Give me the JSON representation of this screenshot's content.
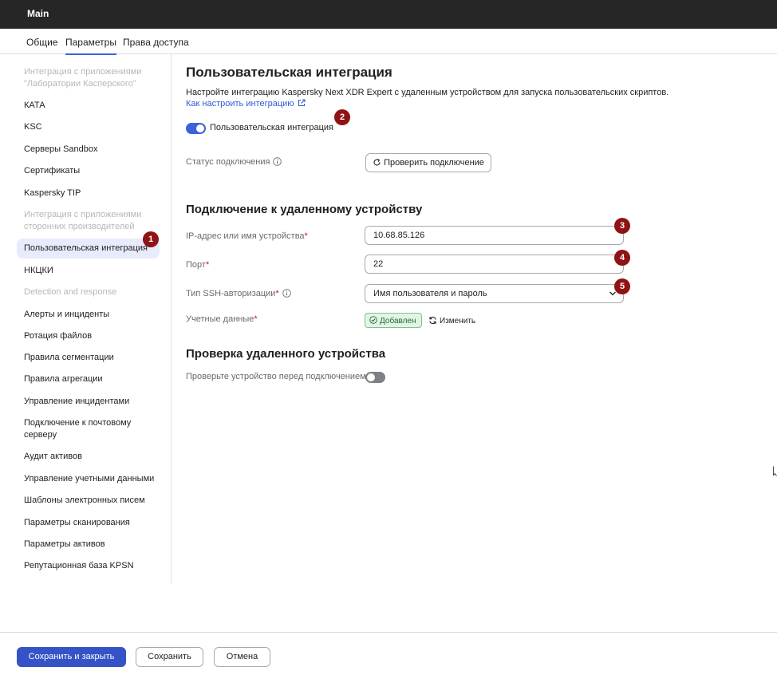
{
  "window": {
    "title": "Main"
  },
  "tabs": [
    {
      "label": "Общие"
    },
    {
      "label": "Параметры"
    },
    {
      "label": "Права доступа"
    }
  ],
  "sidebar": {
    "items": [
      {
        "label": "Интеграция с приложениями \"Лаборатории Касперского\"",
        "type": "group"
      },
      {
        "label": "КАТА",
        "type": "item"
      },
      {
        "label": "KSC",
        "type": "item"
      },
      {
        "label": "Серверы Sandbox",
        "type": "item"
      },
      {
        "label": "Сертификаты",
        "type": "item"
      },
      {
        "label": "Kaspersky TIP",
        "type": "item"
      },
      {
        "label": "Интеграция с приложениями сторонних производителей",
        "type": "group"
      },
      {
        "label": "Пользовательская интеграция",
        "type": "item",
        "selected": true
      },
      {
        "label": "НКЦКИ",
        "type": "item"
      },
      {
        "label": "Detection and response",
        "type": "group"
      },
      {
        "label": "Алерты и инциденты",
        "type": "item"
      },
      {
        "label": "Ротация файлов",
        "type": "item"
      },
      {
        "label": "Правила сегментации",
        "type": "item"
      },
      {
        "label": "Правила агрегации",
        "type": "item"
      },
      {
        "label": "Управление инцидентами",
        "type": "item"
      },
      {
        "label": "Подключение к почтовому серверу",
        "type": "item"
      },
      {
        "label": "Аудит активов",
        "type": "item"
      },
      {
        "label": "Управление учетными данными",
        "type": "item"
      },
      {
        "label": "Шаблоны электронных писем",
        "type": "item"
      },
      {
        "label": "Параметры сканирования",
        "type": "item"
      },
      {
        "label": "Параметры активов",
        "type": "item"
      },
      {
        "label": "Репутационная база KPSN",
        "type": "item"
      }
    ]
  },
  "main": {
    "title": "Пользовательская интеграция",
    "description": "Настройте интеграцию Kaspersky Next XDR Expert с удаленным устройством для запуска пользовательских скриптов.",
    "help_link": "Как настроить интеграцию",
    "integration_toggle": {
      "label": "Пользовательская интеграция",
      "on": true
    },
    "connection_status": {
      "label": "Статус подключения",
      "check_button": "Проверить подключение"
    },
    "remote_section": {
      "title": "Подключение к удаленному устройству",
      "ip": {
        "label": "IP-адрес или имя устройства",
        "required_mark": "*",
        "value": "10.68.85.126"
      },
      "port": {
        "label": "Порт",
        "required_mark": "*",
        "value": "22"
      },
      "ssh_auth": {
        "label": "Тип SSH-авторизации",
        "required_mark": "*",
        "value": "Имя пользователя и пароль"
      },
      "credentials": {
        "label": "Учетные данные",
        "required_mark": "*",
        "status": "Добавлен",
        "change_label": "Изменить"
      }
    },
    "verify_section": {
      "title": "Проверка удаленного устройства",
      "toggle_label": "Проверьте устройство перед подключением",
      "toggle_on": false
    }
  },
  "callouts": [
    "1",
    "2",
    "3",
    "4",
    "5"
  ],
  "footer": {
    "save_close": "Сохранить и закрыть",
    "save": "Сохранить",
    "cancel": "Отмена"
  },
  "colors": {
    "accent": "#3a64d8",
    "primary_button": "#3553c7",
    "callout": "#8f1214",
    "titlebar": "#262626",
    "success": "#1f6b33"
  }
}
